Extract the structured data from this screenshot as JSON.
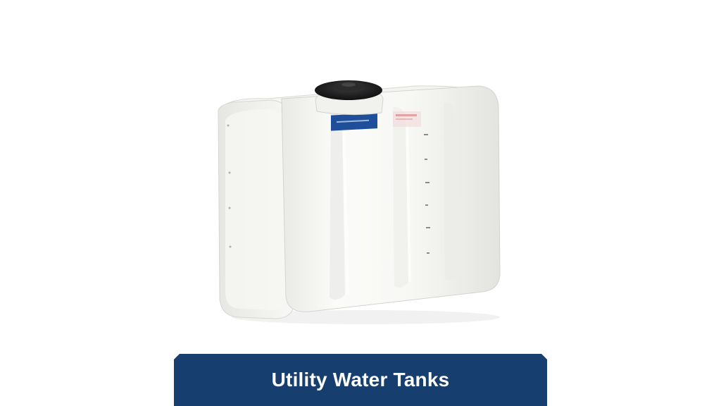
{
  "product": {
    "image_icon": "white-poly-utility-tank",
    "label_color": "#1f4e9a",
    "body_color": "#f4f4f2"
  },
  "caption": {
    "text": "Utility Water Tanks",
    "background_color": "#163e6e",
    "text_color": "#ffffff"
  }
}
